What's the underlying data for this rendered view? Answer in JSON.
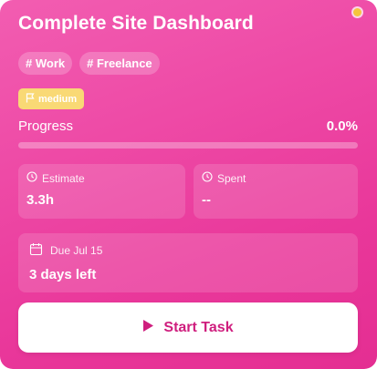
{
  "card": {
    "title": "Complete Site Dashboard",
    "status_dot_color": "#f5c53d",
    "tags": [
      "# Work",
      "# Freelance"
    ],
    "priority": {
      "label": "medium",
      "icon": "flag-icon",
      "color": "#f9d975"
    },
    "progress": {
      "label": "Progress",
      "value_text": "0.0%",
      "value": 0.0
    },
    "estimate": {
      "label": "Estimate",
      "value": "3.3h",
      "icon": "clock-icon"
    },
    "spent": {
      "label": "Spent",
      "value": "--",
      "icon": "clock-icon"
    },
    "due": {
      "label": "Due Jul 15",
      "remaining": "3 days left",
      "icon": "calendar-icon"
    },
    "action": {
      "label": "Start Task",
      "icon": "play-icon",
      "color": "#cf1e7e"
    }
  }
}
